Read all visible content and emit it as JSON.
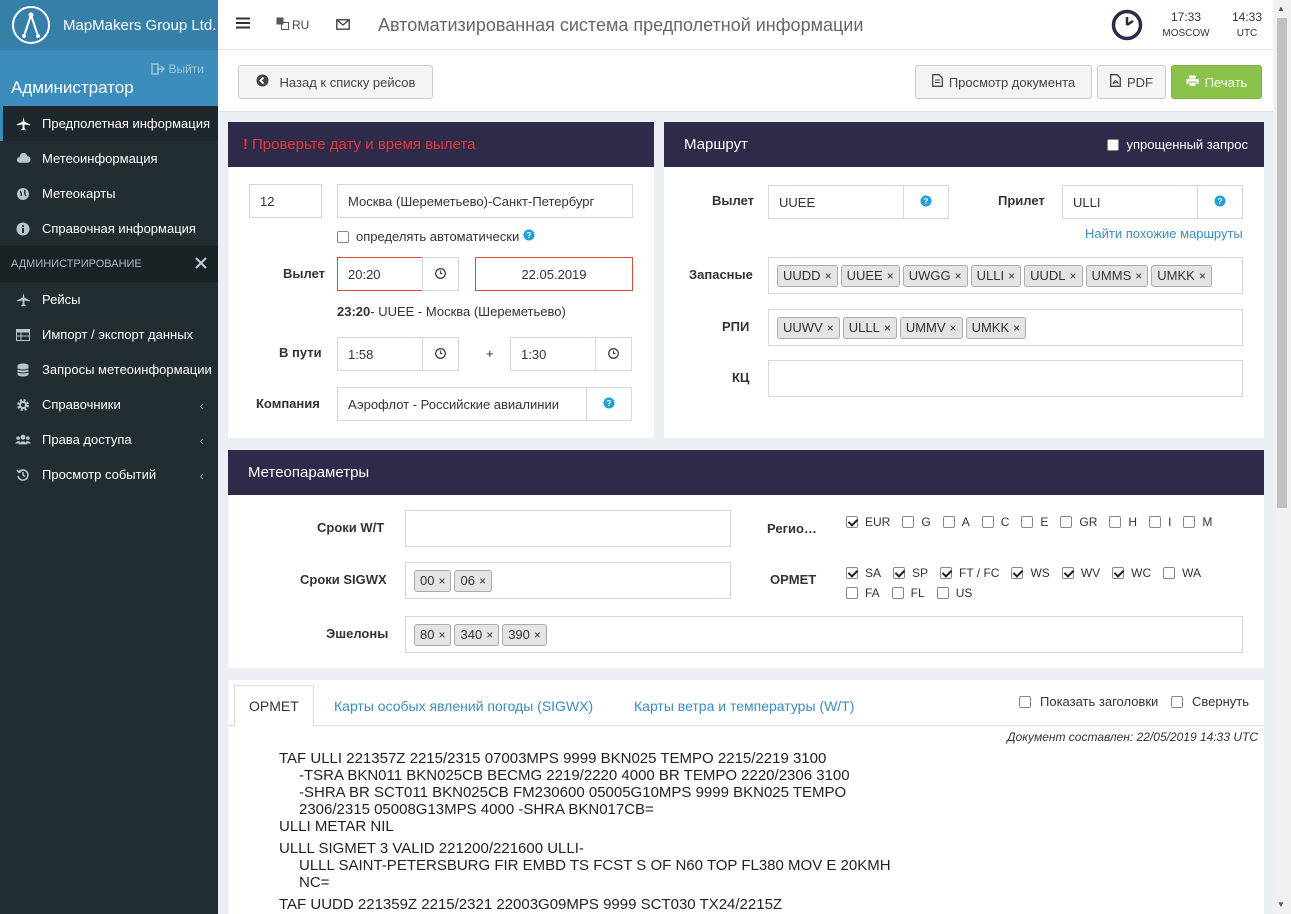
{
  "brand": {
    "name": "MapMakers Group Ltd."
  },
  "user": {
    "role": "Администратор",
    "logout": "Выйти"
  },
  "menu": {
    "main": [
      {
        "label": "Предполетная информация",
        "icon": "plane-icon"
      },
      {
        "label": "Метеоинформация",
        "icon": "cloud-icon"
      },
      {
        "label": "Метеокарты",
        "icon": "globe-icon"
      },
      {
        "label": "Справочная информация",
        "icon": "info-icon"
      }
    ],
    "admin_header": "АДМИНИСТРИРОВАНИЕ",
    "admin": [
      {
        "label": "Рейсы",
        "icon": "plane-icon"
      },
      {
        "label": "Импорт / экспорт данных",
        "icon": "table-icon"
      },
      {
        "label": "Запросы метеоинформации",
        "icon": "database-icon"
      },
      {
        "label": "Справочники",
        "icon": "gear-icon"
      },
      {
        "label": "Права доступа",
        "icon": "users-icon"
      },
      {
        "label": "Просмотр событий",
        "icon": "history-icon"
      }
    ]
  },
  "topbar": {
    "lang": "RU",
    "title": "Автоматизированная система предполетной информации",
    "time_local": "17:33",
    "tz_local": "MOSCOW",
    "time_utc": "14:33",
    "tz_utc": "UTC"
  },
  "toolbar": {
    "back": "Назад к списку рейсов",
    "view": "Просмотр документа",
    "pdf": "PDF",
    "print": "Печать"
  },
  "flight": {
    "warning_mark": "!",
    "warning": "Проверьте дату и время вылета",
    "number": "12",
    "route_name": "Москва (Шереметьево)-Санкт-Петербург",
    "auto_label": "определять автоматически",
    "dep_label": "Вылет",
    "dep_time": "20:20",
    "dep_date": "22.05.2019",
    "dep_info_time": "23:20",
    "dep_info_rest": "- UUEE - Москва (Шереметьево)",
    "enroute_label": "В пути",
    "enroute": "1:58",
    "plus": "+",
    "extra": "1:30",
    "company_label": "Компания",
    "company": "Аэрофлот - Российские авиалинии"
  },
  "route": {
    "title": "Маршрут",
    "simple": "упрощенный запрос",
    "dep_label": "Вылет",
    "dep": "UUEE",
    "arr_label": "Прилет",
    "arr": "ULLI",
    "similar": "Найти похожие маршруты",
    "alt_label": "Запасные",
    "alternates": [
      "UUDD",
      "UUEE",
      "UWGG",
      "ULLI",
      "UUDL",
      "UMMS",
      "UMKK"
    ],
    "fir_label": "РПИ",
    "firs": [
      "UUWV",
      "ULLL",
      "UMMV",
      "UMKK"
    ],
    "kc_label": "КЦ"
  },
  "meteo": {
    "title": "Метеопараметры",
    "wt_label": "Сроки W/T",
    "sigwx_label": "Сроки SIGWX",
    "sigwx": [
      "00",
      "06"
    ],
    "levels_label": "Эшелоны",
    "levels": [
      "80",
      "340",
      "390"
    ],
    "regions_label": "Регио…",
    "regions": [
      {
        "l": "EUR",
        "on": true
      },
      {
        "l": "G",
        "on": false
      },
      {
        "l": "A",
        "on": false
      },
      {
        "l": "C",
        "on": false
      },
      {
        "l": "E",
        "on": false
      },
      {
        "l": "GR",
        "on": false
      },
      {
        "l": "H",
        "on": false
      },
      {
        "l": "I",
        "on": false
      },
      {
        "l": "M",
        "on": false
      }
    ],
    "opmet_label": "OPMET",
    "opmet_row1": [
      {
        "l": "SA",
        "on": true
      },
      {
        "l": "SP",
        "on": true
      },
      {
        "l": "FT / FC",
        "on": true
      },
      {
        "l": "WS",
        "on": true
      },
      {
        "l": "WV",
        "on": true
      },
      {
        "l": "WC",
        "on": true
      },
      {
        "l": "WA",
        "on": false
      }
    ],
    "opmet_row2": [
      {
        "l": "FA",
        "on": false
      },
      {
        "l": "FL",
        "on": false
      },
      {
        "l": "US",
        "on": false
      }
    ]
  },
  "tabs": {
    "items": [
      "OPMET",
      "Карты особых явлений погоды (SIGWX)",
      "Карты ветра и температуры (W/T)"
    ],
    "show_headers": "Показать заголовки",
    "collapse": "Свернуть",
    "composed": "Документ составлен: 22/05/2019 14:33 UTC",
    "lines": [
      "TAF ULLI 221357Z 2215/2315 07003MPS 9999 BKN025 TEMPO 2215/2219 3100",
      "-TSRA BKN011 BKN025CB BECMG 2219/2220 4000 BR TEMPO 2220/2306 3100",
      "-SHRA BR SCT011 BKN025CB FM230600 05005G10MPS 9999 BKN025 TEMPO",
      "2306/2315 05008G13MPS 4000 -SHRA BKN017CB=",
      "ULLI METAR NIL",
      "ULLL SIGMET 3 VALID 221200/221600 ULLI-",
      "ULLL SAINT-PETERSBURG FIR EMBD TS FCST S OF N60 TOP FL380 MOV E 20KMH",
      "NC=",
      "TAF UUDD 221359Z 2215/2321 22003G09MPS 9999 SCT030 TX24/2215Z"
    ]
  }
}
